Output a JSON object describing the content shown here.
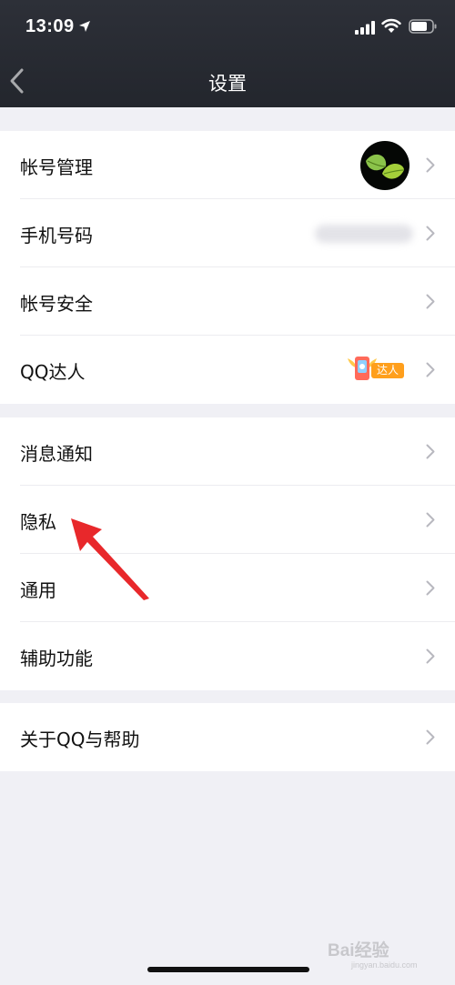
{
  "status_bar": {
    "time": "13:09"
  },
  "nav": {
    "title": "设置"
  },
  "groups": [
    {
      "items": [
        {
          "label": "帐号管理"
        },
        {
          "label": "手机号码"
        },
        {
          "label": "帐号安全"
        },
        {
          "label": "QQ达人",
          "badge": "达人"
        }
      ]
    },
    {
      "items": [
        {
          "label": "消息通知"
        },
        {
          "label": "隐私"
        },
        {
          "label": "通用"
        },
        {
          "label": "辅助功能"
        }
      ]
    },
    {
      "items": [
        {
          "label": "关于QQ与帮助"
        }
      ]
    }
  ],
  "watermark": {
    "text": "Bai经验",
    "sub": "jingyan.baidu.com"
  },
  "colors": {
    "header": "#2a2d35",
    "background": "#f0f0f5",
    "arrow": "#e8282b",
    "badge": "#ff9f1c"
  },
  "icons": [
    "location-arrow-icon",
    "signal-icon",
    "wifi-icon",
    "battery-icon",
    "back-chevron-icon",
    "chevron-right-icon",
    "avatar-leaf-icon",
    "daren-wings-icon"
  ]
}
